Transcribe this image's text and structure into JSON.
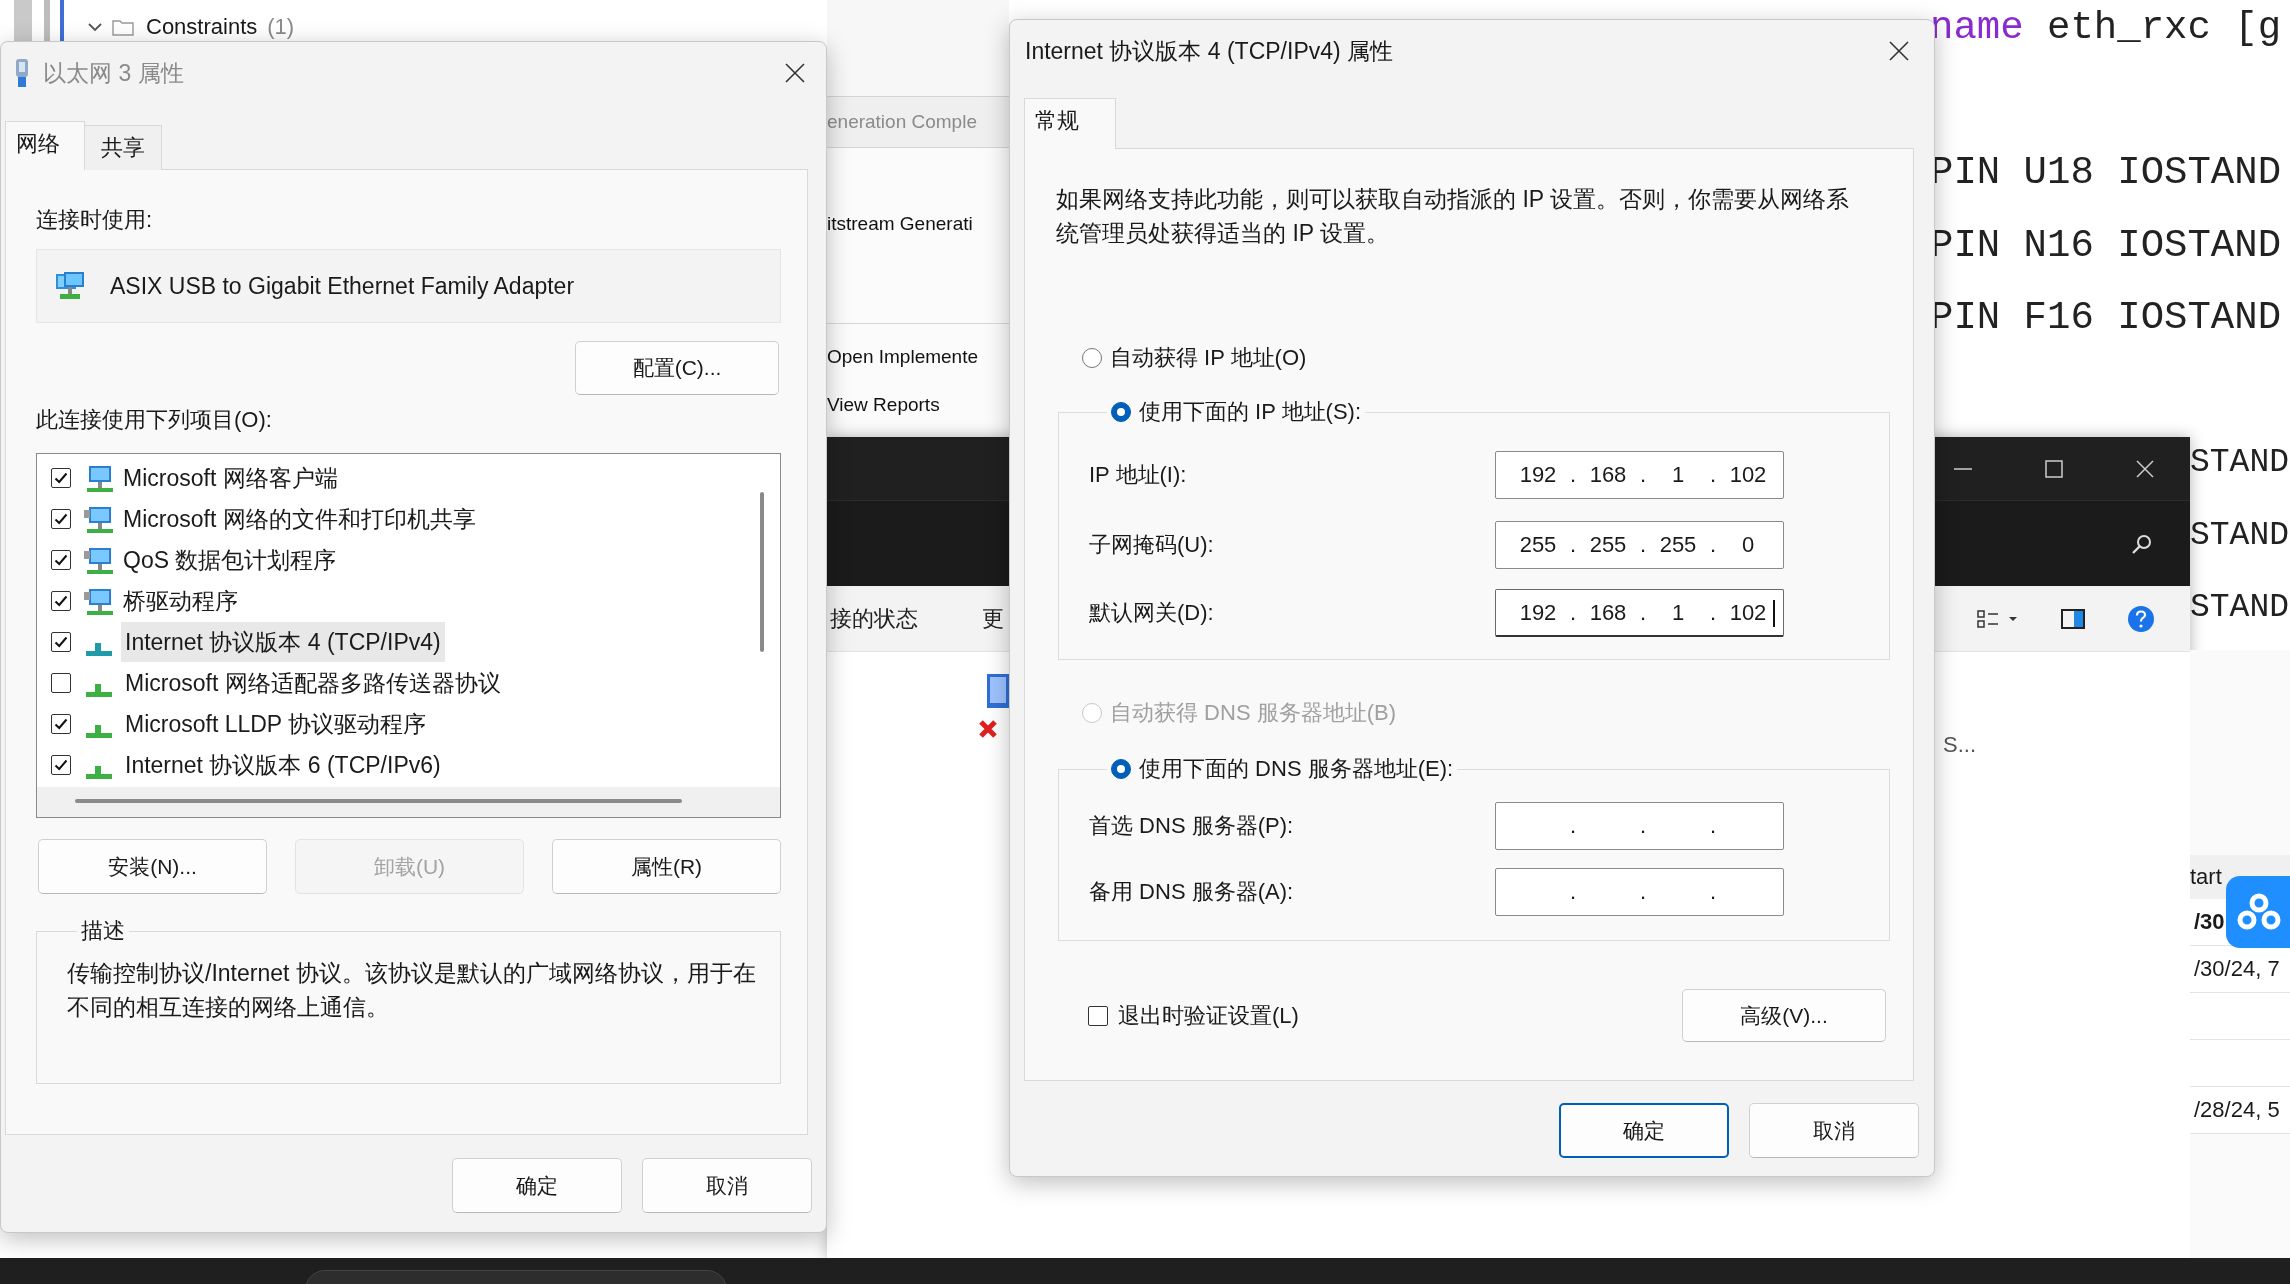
{
  "desktop_background": {
    "sources_tree": {
      "item": {
        "label": "Constraints",
        "count": "(1)",
        "expanded": true
      }
    },
    "flow_navigator": {
      "header": "eneration Comple",
      "items": [
        "itstream Generati",
        "Open Implemente",
        "View Reports"
      ]
    },
    "editor": {
      "lines": [
        {
          "keyword": "name",
          "text": "eth_rxc [g"
        },
        {
          "text": "PIN U18 IOSTAND"
        },
        {
          "text": "PIN N16 IOSTAND"
        },
        {
          "text": "PIN F16 IOSTAND"
        }
      ],
      "lines_beside_window": [
        "STAND",
        "STAND",
        "STAND"
      ]
    },
    "explorer_window": {
      "toolbar_items": [
        "接的状态",
        "更"
      ],
      "list_item": "S..."
    },
    "runs_table": {
      "header": "tart",
      "rows": [
        {
          "text": "/30",
          "bold": true
        },
        {
          "text": "/30/24, 7",
          "bold": false
        },
        {},
        {},
        {
          "text": "/28/24, 5",
          "bold": false
        }
      ]
    }
  },
  "ethernet_properties": {
    "title": "以太网 3 属性",
    "active": false,
    "tabs": [
      {
        "label": "网络",
        "selected": true
      },
      {
        "label": "共享",
        "selected": false
      }
    ],
    "connect_using_label": "连接时使用:",
    "adapter": "ASIX USB to Gigabit Ethernet Family Adapter",
    "configure_button": "配置(C)...",
    "items_label": "此连接使用下列项目(O):",
    "items": [
      {
        "kind": "client",
        "label": "Microsoft 网络客户端",
        "checked": true,
        "selected": false
      },
      {
        "kind": "service",
        "label": "Microsoft 网络的文件和打印机共享",
        "checked": true,
        "selected": false
      },
      {
        "kind": "service",
        "label": "QoS 数据包计划程序",
        "checked": true,
        "selected": false
      },
      {
        "kind": "service",
        "label": "桥驱动程序",
        "checked": true,
        "selected": false
      },
      {
        "kind": "protocol",
        "label": "Internet 协议版本 4 (TCP/IPv4)",
        "checked": true,
        "selected": true
      },
      {
        "kind": "protocol",
        "label": "Microsoft 网络适配器多路传送器协议",
        "checked": false,
        "selected": false
      },
      {
        "kind": "protocol",
        "label": "Microsoft LLDP 协议驱动程序",
        "checked": true,
        "selected": false
      },
      {
        "kind": "protocol",
        "label": "Internet 协议版本 6 (TCP/IPv6)",
        "checked": true,
        "selected": false
      }
    ],
    "item_buttons": [
      {
        "label": "安装(N)...",
        "disabled": false
      },
      {
        "label": "卸载(U)",
        "disabled": true
      },
      {
        "label": "属性(R)",
        "disabled": false
      }
    ],
    "description": {
      "title": "描述",
      "text": "传输控制协议/Internet 协议。该协议是默认的广域网络协议，用于在不同的相互连接的网络上通信。"
    },
    "buttons": [
      {
        "label": "确定",
        "default": false
      },
      {
        "label": "取消",
        "default": false
      }
    ]
  },
  "ipv4_properties": {
    "title": "Internet 协议版本 4 (TCP/IPv4) 属性",
    "active": true,
    "tabs": [
      {
        "label": "常规",
        "selected": true
      }
    ],
    "intro": "如果网络支持此功能，则可以获取自动指派的 IP 设置。否则，你需要从网络系统管理员处获得适当的 IP 设置。",
    "ip_mode": [
      {
        "label": "自动获得 IP 地址(O)",
        "selected": false,
        "disabled": false
      },
      {
        "label": "使用下面的 IP 地址(S):",
        "selected": true,
        "disabled": false
      }
    ],
    "ip_fields": [
      {
        "label": "IP 地址(I):",
        "octets": [
          "192",
          "168",
          "1",
          "102"
        ],
        "separators": [
          ".",
          ".",
          "."
        ],
        "focused": false
      },
      {
        "label": "子网掩码(U):",
        "octets": [
          "255",
          "255",
          "255",
          "0"
        ],
        "separators": [
          ".",
          ".",
          "."
        ],
        "focused": false
      },
      {
        "label": "默认网关(D):",
        "octets": [
          "192",
          "168",
          "1",
          "102"
        ],
        "separators": [
          ".",
          ".",
          "."
        ],
        "focused": true
      }
    ],
    "dns_mode": [
      {
        "label": "自动获得 DNS 服务器地址(B)",
        "selected": false,
        "disabled": true
      },
      {
        "label": "使用下面的 DNS 服务器地址(E):",
        "selected": true,
        "disabled": false
      }
    ],
    "dns_fields": [
      {
        "label": "首选 DNS 服务器(P):",
        "separators": [
          ".",
          ".",
          "."
        ],
        "focused": false
      },
      {
        "label": "备用 DNS 服务器(A):",
        "separators": [
          ".",
          ".",
          "."
        ],
        "focused": false
      }
    ],
    "validate_on_exit": {
      "label": "退出时验证设置(L)",
      "checked": false
    },
    "advanced_button": "高级(V)...",
    "buttons": [
      {
        "label": "确定",
        "default": true
      },
      {
        "label": "取消",
        "default": false
      }
    ]
  }
}
